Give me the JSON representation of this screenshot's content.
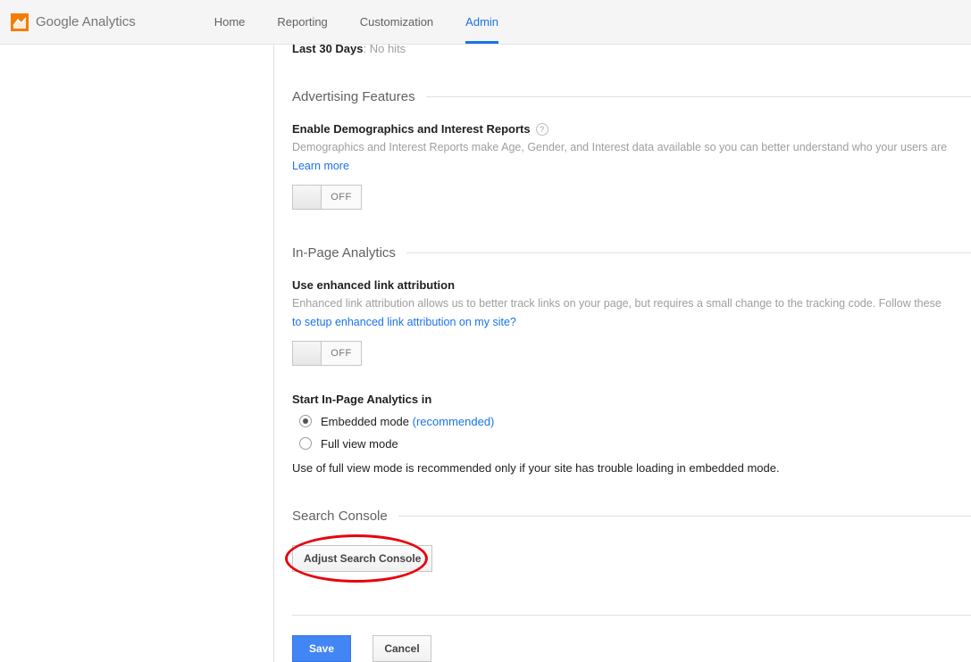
{
  "brand": {
    "name": "Google Analytics"
  },
  "nav": {
    "items": [
      {
        "label": "Home"
      },
      {
        "label": "Reporting"
      },
      {
        "label": "Customization"
      },
      {
        "label": "Admin"
      }
    ]
  },
  "cutoff": {
    "bold": "Last 30 Days",
    "rest": ": No hits"
  },
  "sections": {
    "advertising": {
      "title": "Advertising Features",
      "field_label": "Enable Demographics and Interest Reports",
      "desc": "Demographics and Interest Reports make Age, Gender, and Interest data available so you can better understand who your users are",
      "learn_more": "Learn more",
      "toggle": "OFF"
    },
    "inpage": {
      "title": "In-Page Analytics",
      "field_label": "Use enhanced link attribution",
      "desc": "Enhanced link attribution allows us to better track links on your page, but requires a small change to the tracking code. Follow these",
      "setup_link": "to setup enhanced link attribution on my site?",
      "toggle": "OFF",
      "start_label": "Start In-Page Analytics in",
      "radio1_label": "Embedded mode ",
      "radio1_paren": "(recommended)",
      "radio2_label": "Full view mode",
      "note": "Use of full view mode is recommended only if your site has trouble loading in embedded mode."
    },
    "search_console": {
      "title": "Search Console",
      "button": "Adjust Search Console"
    }
  },
  "actions": {
    "save": "Save",
    "cancel": "Cancel"
  }
}
